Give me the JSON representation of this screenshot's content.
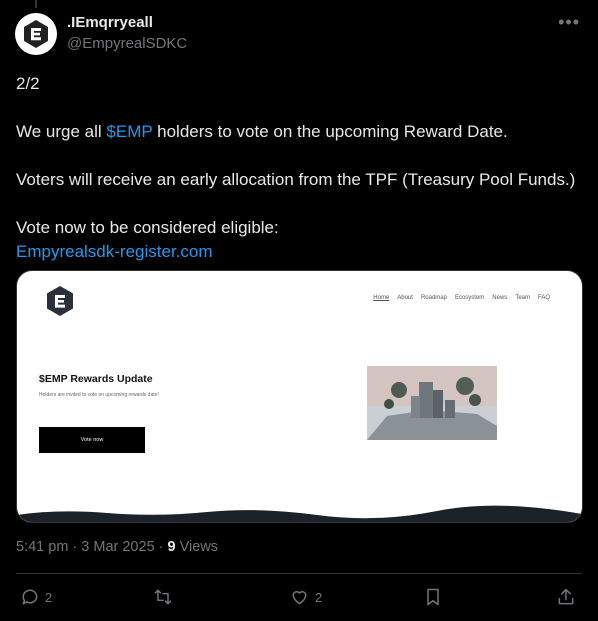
{
  "author": {
    "display_name": ".IEmqrryeall",
    "handle": "@EmpyrealSDKC"
  },
  "tweet": {
    "line1": "2/2",
    "line2_before": "We urge all ",
    "line2_cashtag": "$EMP",
    "line2_after": " holders to vote on the upcoming Reward Date.",
    "line3": "Voters will receive an early allocation from the TPF (Treasury Pool Funds.)",
    "line4": "Vote now to be considered eligible:",
    "link": "Empyrealsdk-register.com"
  },
  "card": {
    "nav": [
      "Home",
      "About",
      "Roadmap",
      "Ecosystem",
      "News",
      "Team",
      "FAQ"
    ],
    "heading": "$EMP Rewards Update",
    "subtext": "Holders are invited to vote on upcoming rewards date!",
    "button": "Vote now"
  },
  "meta": {
    "time": "5:41 pm · 3 Mar 2025 · ",
    "views_count": "9",
    "views_label": " Views"
  },
  "actions": {
    "replies": "2",
    "likes": "2"
  },
  "colors": {
    "background": "#000000",
    "text": "#e7e9ea",
    "secondary": "#71767b",
    "link": "#1d9bf0"
  }
}
